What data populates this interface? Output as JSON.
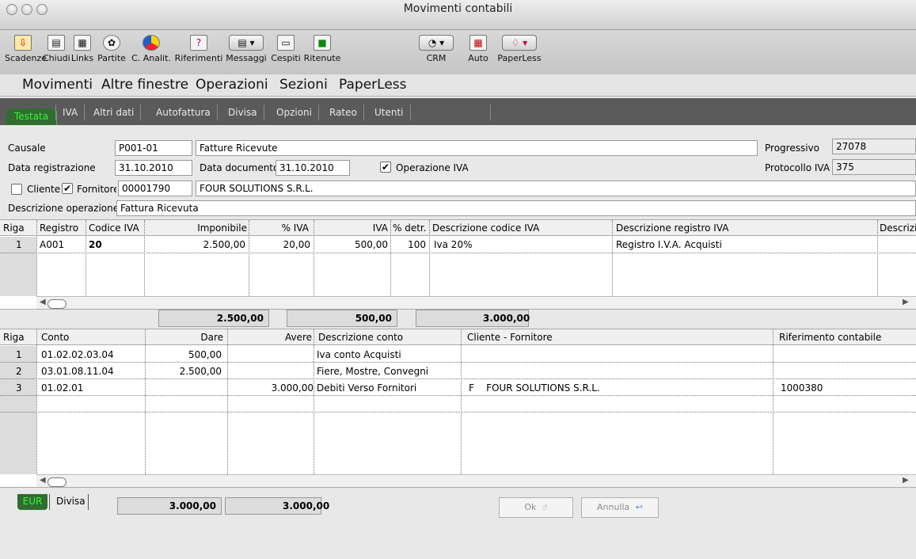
{
  "window": {
    "title": "Movimenti contabili"
  },
  "toolbar": [
    {
      "label": "Scadenze",
      "icon": "due-dates-icon"
    },
    {
      "label": "Chiudi",
      "icon": "close-doc-icon"
    },
    {
      "label": "Links",
      "icon": "links-icon"
    },
    {
      "label": "Partite",
      "icon": "items-icon"
    },
    {
      "label": "C. Analit.",
      "icon": "pie-chart-icon"
    },
    {
      "label": "Riferimenti",
      "icon": "references-icon"
    },
    {
      "label": "Messaggi",
      "icon": "messages-icon"
    },
    {
      "label": "Cespiti",
      "icon": "assets-icon"
    },
    {
      "label": "Ritenute",
      "icon": "withholding-icon"
    },
    {
      "label": "CRM",
      "icon": "crm-icon"
    },
    {
      "label": "Auto",
      "icon": "calculator-icon"
    },
    {
      "label": "PaperLess",
      "icon": "paperless-icon"
    }
  ],
  "menu": [
    "Movimenti",
    "Altre finestre",
    "Operazioni",
    "Sezioni",
    "PaperLess"
  ],
  "tabs": [
    "Testata",
    "IVA",
    "Altri dati",
    "Autofattura",
    "Divisa",
    "Opzioni",
    "Rateo",
    "Utenti"
  ],
  "form": {
    "causale_label": "Causale",
    "causale_code": "P001-01",
    "causale_desc": "Fatture Ricevute",
    "progressivo_label": "Progressivo",
    "progressivo_value": "27078",
    "data_reg_label": "Data registrazione",
    "data_reg_value": "31.10.2010",
    "data_doc_label": "Data documento",
    "data_doc_value": "31.10.2010",
    "operazione_iva_label": "Operazione IVA",
    "operazione_iva_checked": true,
    "protocollo_label": "Protocollo IVA",
    "protocollo_value": "375",
    "cliente_label": "Cliente",
    "cliente_checked": false,
    "fornitore_label": "Fornitore",
    "fornitore_checked": true,
    "fornitore_code": "00001790",
    "fornitore_name": "FOUR SOLUTIONS S.R.L.",
    "desc_op_label": "Descrizione operazione",
    "desc_op_value": "Fattura Ricevuta"
  },
  "iva_grid": {
    "headers": [
      "Riga",
      "Registro",
      "Codice IVA",
      "Imponibile",
      "% IVA",
      "IVA",
      "% detr.",
      "Descrizione codice IVA",
      "Descrizione registro IVA",
      "Descrizi"
    ],
    "rows": [
      [
        "1",
        "A001",
        "20",
        "2.500,00",
        "20,00",
        "500,00",
        "100",
        "Iva 20%",
        "Registro I.V.A. Acquisti",
        ""
      ]
    ],
    "totals": [
      "2.500,00",
      "500,00",
      "3.000,00"
    ]
  },
  "conti_grid": {
    "headers": [
      "Riga",
      "Conto",
      "Dare",
      "Avere",
      "Descrizione conto",
      "Cliente - Fornitore",
      "Riferimento contabile"
    ],
    "rows": [
      [
        "1",
        "01.02.02.03.04",
        "500,00",
        "",
        "Iva conto Acquisti",
        "",
        ""
      ],
      [
        "2",
        "03.01.08.11.04",
        "2.500,00",
        "",
        "Fiere, Mostre, Convegni",
        "",
        ""
      ],
      [
        "3",
        "01.02.01",
        "",
        "3.000,00",
        "Debiti Verso Fornitori",
        "F    FOUR SOLUTIONS S.R.L.",
        "1000380"
      ]
    ],
    "totals": [
      "3.000,00",
      "3.000,00"
    ]
  },
  "bottom_tabs": [
    "EUR",
    "Divisa"
  ],
  "buttons": {
    "ok": "Ok",
    "annulla": "Annulla"
  }
}
